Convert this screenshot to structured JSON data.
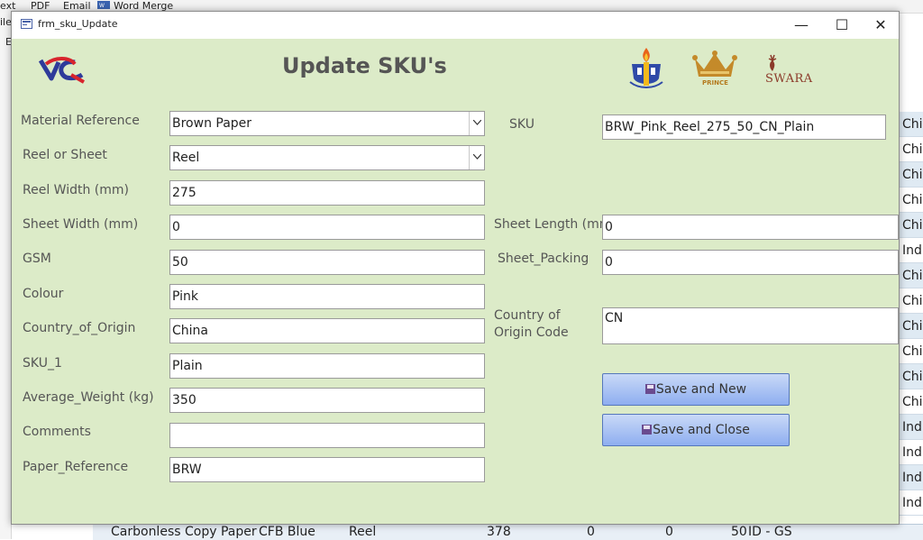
{
  "background_app": {
    "ribbon": [
      "ext",
      "PDF",
      "Email",
      "Word Merge"
    ],
    "side_labels": [
      "ile",
      "E"
    ],
    "grid_cells": [
      "Chi",
      "Chi",
      "Chi",
      "Chi",
      "Chi",
      "Ind",
      "Chi",
      "Chi",
      "Chi",
      "Chi",
      "Chi",
      "Chi",
      "Ind",
      "Ind",
      "Ind",
      "Ind"
    ],
    "bottom_row": {
      "material": "Carbonless Copy Paper",
      "colour": "CFB Blue",
      "type": "Reel",
      "weight": "378",
      "v1": "0",
      "v2": "0",
      "gsm": "50",
      "code": "ID - GS"
    }
  },
  "window": {
    "title": "frm_sku_Update",
    "minimize": "—",
    "maximize": "☐",
    "close": "✕"
  },
  "heading": "Update SKU's",
  "logos": {
    "vcl": "VCL",
    "prince": "PRINCE",
    "swara": "SWARA"
  },
  "form": {
    "material_reference": {
      "label": "Material Reference",
      "value": "Brown Paper"
    },
    "reel_or_sheet": {
      "label": "Reel or Sheet",
      "value": "Reel"
    },
    "reel_width": {
      "label": "Reel Width (mm)",
      "value": "275"
    },
    "sheet_width": {
      "label": "Sheet Width (mm)",
      "value": "0"
    },
    "gsm": {
      "label": "GSM",
      "value": "50"
    },
    "colour": {
      "label": "Colour",
      "value": "Pink"
    },
    "country_of_origin": {
      "label": "Country_of_Origin",
      "value": "China"
    },
    "sku_1": {
      "label": "SKU_1",
      "value": "Plain"
    },
    "average_weight": {
      "label": "Average_Weight (kg)",
      "value": "350"
    },
    "comments": {
      "label": "Comments",
      "value": ""
    },
    "paper_reference": {
      "label": "Paper_Reference",
      "value": "BRW"
    },
    "sku": {
      "label": "SKU",
      "value": "BRW_Pink_Reel_275_50_CN_Plain"
    },
    "sheet_length": {
      "label": "Sheet Length (mm",
      "value": "0"
    },
    "sheet_packing": {
      "label": "Sheet_Packing",
      "value": "0"
    },
    "country_code": {
      "label_line1": "Country of",
      "label_line2": "Origin Code",
      "value": "CN"
    }
  },
  "buttons": {
    "save_new": "Save and New",
    "save_close": "Save and Close"
  }
}
